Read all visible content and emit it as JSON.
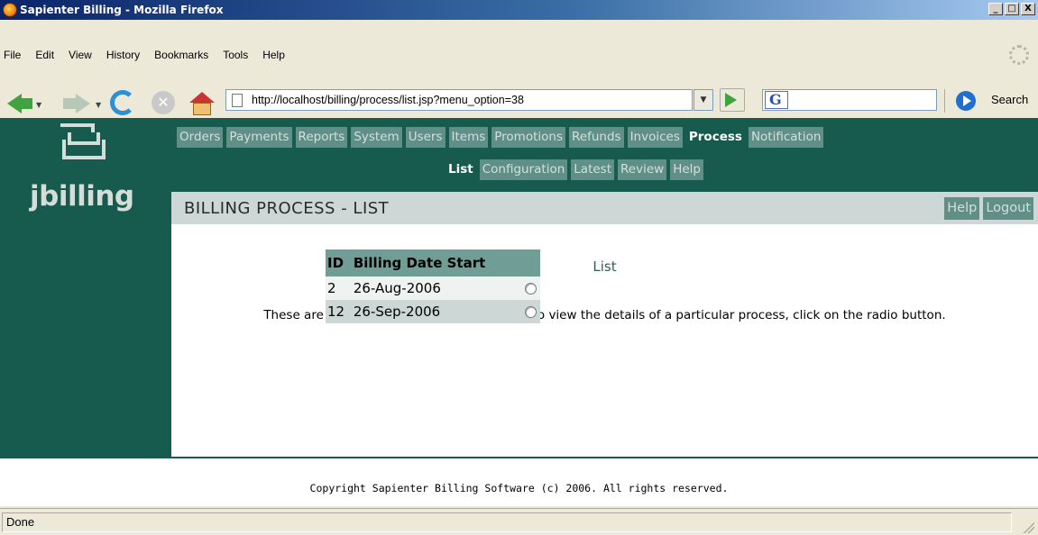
{
  "window": {
    "title": "Sapienter Billing - Mozilla Firefox",
    "min": "_",
    "max": "□",
    "close": "X"
  },
  "menubar": {
    "items": [
      {
        "label": "File",
        "hotkey": "F"
      },
      {
        "label": "Edit",
        "hotkey": "E"
      },
      {
        "label": "View",
        "hotkey": "V"
      },
      {
        "label": "History",
        "hotkey": "s"
      },
      {
        "label": "Bookmarks",
        "hotkey": "B"
      },
      {
        "label": "Tools",
        "hotkey": "T"
      },
      {
        "label": "Help",
        "hotkey": "H"
      }
    ]
  },
  "toolbar": {
    "url": "http://localhost/billing/process/list.jsp?menu_option=38",
    "search_value": "",
    "search_label": "Search",
    "search_engine_glyph": "G"
  },
  "app": {
    "logo_text": "jbilling",
    "main_menu": [
      "Orders",
      "Payments",
      "Reports",
      "System",
      "Users",
      "Items",
      "Promotions",
      "Refunds",
      "Invoices",
      "Process",
      "Notification"
    ],
    "main_menu_active": "Process",
    "sub_menu": [
      "List",
      "Configuration",
      "Latest",
      "Review",
      "Help"
    ],
    "sub_menu_active": "List",
    "page_heading": "BILLING PROCESS - LIST",
    "head_links": [
      "Help",
      "Logout"
    ],
    "section_title": "List",
    "intro": "These are the billing processes run to date. To view the details of a particular process, click on the radio button.",
    "table": {
      "headers": [
        "ID",
        "Billing Date Start",
        ""
      ],
      "rows": [
        {
          "id": "2",
          "date": "26-Aug-2006"
        },
        {
          "id": "12",
          "date": "26-Sep-2006"
        }
      ]
    },
    "copyright": "Copyright Sapienter Billing Software (c) 2006. All rights reserved."
  },
  "status": {
    "text": "Done"
  },
  "colors": {
    "brand_green": "#165b4e",
    "tab_bg": "#5f8f87",
    "head_bar": "#cdd8d6"
  }
}
